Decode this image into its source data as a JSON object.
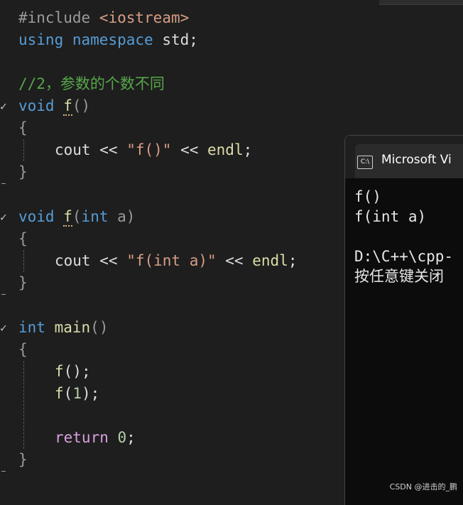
{
  "editor": {
    "lines": {
      "l0": {
        "pp": "#include",
        "inc": "<iostream>"
      },
      "l1": {
        "kw": "using",
        "kw2": "namespace",
        "txt": "std;"
      },
      "l3": {
        "comment": "//2，参数的个数不同"
      },
      "l4": {
        "kw": "void",
        "fn": "f",
        "par": "()"
      },
      "l5": {
        "brace": "{"
      },
      "l6": {
        "obj": "cout",
        "op1": "<<",
        "str": "\"f()\"",
        "op2": "<<",
        "endl": "endl",
        "semi": ";"
      },
      "l7": {
        "brace": "}"
      },
      "l9": {
        "kw": "void",
        "fn": "f",
        "par_open": "(",
        "kw_int": "int",
        "param": "a",
        "par_close": ")"
      },
      "l10": {
        "brace": "{"
      },
      "l11": {
        "obj": "cout",
        "op1": "<<",
        "str": "\"f(int a)\"",
        "op2": "<<",
        "endl": "endl",
        "semi": ";"
      },
      "l12": {
        "brace": "}"
      },
      "l14": {
        "kw": "int",
        "fn": "main",
        "par": "()"
      },
      "l15": {
        "brace": "{"
      },
      "l16": {
        "fn": "f",
        "rest": "();"
      },
      "l17": {
        "fn": "f",
        "par_open": "(",
        "num": "1",
        "rest": ");"
      },
      "l19": {
        "ctl": "return",
        "num": "0",
        "semi": ";"
      },
      "l20": {
        "brace": "}"
      }
    }
  },
  "console": {
    "title": "Microsoft Vi",
    "icon": "C:\\",
    "output": [
      "f()",
      "f(int a)",
      "",
      "D:\\C++\\cpp-",
      "按任意键关闭"
    ]
  },
  "watermark": "CSDN @进击的_鹏",
  "colors": {
    "background": "#1e1e1e",
    "keyword": "#569cd6",
    "function": "#dcdcaa",
    "string": "#d69d85",
    "comment": "#57a64a",
    "control": "#d8a0df",
    "number": "#b5cea8",
    "console_bg": "#0c0c0c"
  }
}
